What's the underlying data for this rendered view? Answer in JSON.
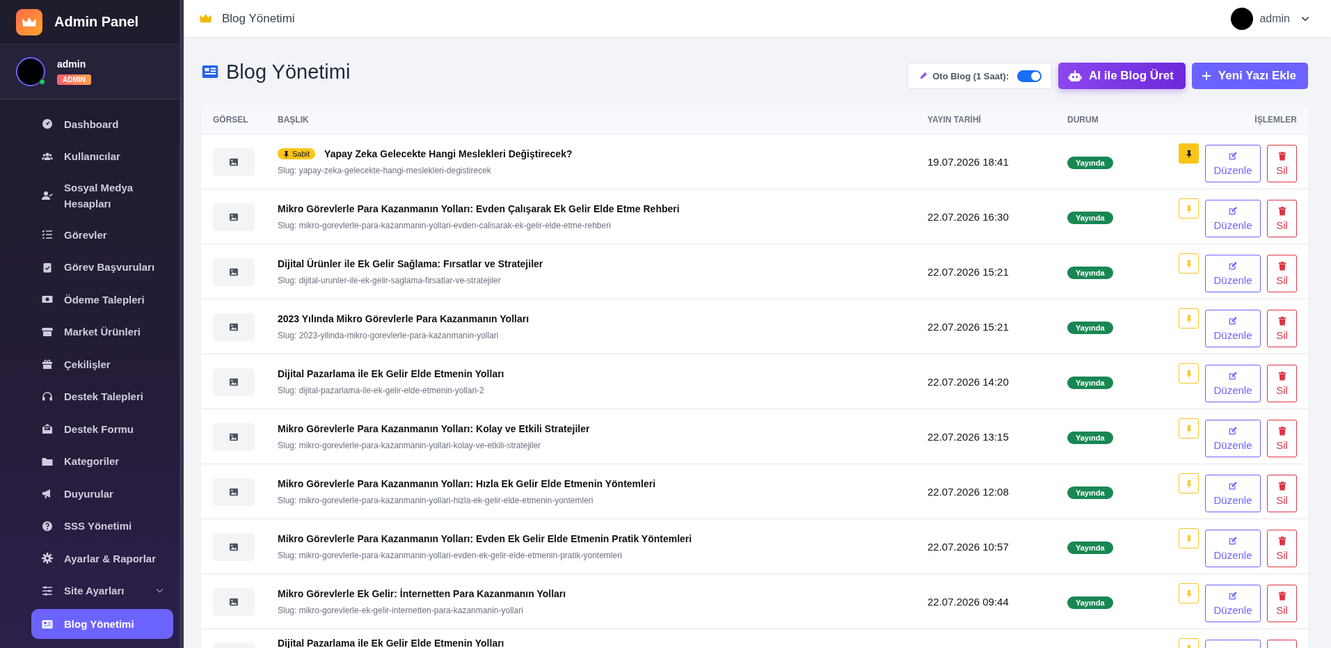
{
  "sidebar": {
    "brand": "Admin Panel",
    "user": {
      "name": "admin",
      "role": "ADMIN",
      "online": true
    },
    "items": [
      {
        "label": "Dashboard",
        "kind": "link",
        "selected": false
      },
      {
        "label": "Kullanıcılar",
        "kind": "link",
        "selected": false
      },
      {
        "label": "Sosyal Medya Hesapları",
        "kind": "link",
        "selected": false
      },
      {
        "label": "Görevler",
        "kind": "link",
        "selected": false
      },
      {
        "label": "Görev Başvuruları",
        "kind": "link",
        "selected": false
      },
      {
        "label": "Ödeme Talepleri",
        "kind": "link",
        "selected": false
      },
      {
        "label": "Market Ürünleri",
        "kind": "link",
        "selected": false
      },
      {
        "label": "Çekilişler",
        "kind": "link",
        "selected": false
      },
      {
        "label": "Destek Talepleri",
        "kind": "link",
        "selected": false
      },
      {
        "label": "Destek Formu",
        "kind": "link",
        "selected": false
      },
      {
        "label": "Kategoriler",
        "kind": "link",
        "selected": false
      },
      {
        "label": "Duyurular",
        "kind": "link",
        "selected": false
      },
      {
        "label": "SSS Yönetimi",
        "kind": "link",
        "selected": false
      },
      {
        "label": "Ayarlar & Raporlar",
        "kind": "link",
        "selected": false
      },
      {
        "label": "Site Ayarları",
        "kind": "group",
        "selected": false
      },
      {
        "label": "Blog Yönetimi",
        "kind": "link",
        "selected": true
      }
    ]
  },
  "topbar": {
    "title": "Blog Yönetimi",
    "user": "admin"
  },
  "page": {
    "title": "Blog Yönetimi",
    "auto_blog": {
      "label": "Oto Blog (1 Saat):",
      "on": true
    },
    "buttons": [
      {
        "label": "AI ile Blog Üret",
        "kind": "ai"
      },
      {
        "label": "Yeni Yazı Ekle",
        "kind": "add"
      }
    ]
  },
  "table": {
    "columns": [
      "GÖRSEL",
      "BAŞLIK",
      "YAYIN TARİHİ",
      "DURUM",
      "İŞLEMLER"
    ],
    "pinned_badge": "Sabit",
    "rows": [
      {
        "title": "Yapay Zeka Gelecekte Hangi Meslekleri Değiştirecek?",
        "slug": "Slug: yapay-zeka-gelecekte-hangi-meslekleri-degistirecek",
        "date": "19.07.2026 18:41",
        "status": "Yayında",
        "pinned": true,
        "edit_label": "Düzenle",
        "delete_label": "Sil"
      },
      {
        "title": "Mikro Görevlerle Para Kazanmanın Yolları: Evden Çalışarak Ek Gelir Elde Etme Rehberi",
        "slug": "Slug: mikro-gorevlerle-para-kazanmanin-yollari-evden-calisarak-ek-gelir-elde-etme-rehberi",
        "date": "22.07.2026 16:30",
        "status": "Yayında",
        "pinned": false,
        "edit_label": "Düzenle",
        "delete_label": "Sil"
      },
      {
        "title": "Dijital Ürünler ile Ek Gelir Sağlama: Fırsatlar ve Stratejiler",
        "slug": "Slug: dijital-urunler-ile-ek-gelir-saglama-firsatlar-ve-stratejiler",
        "date": "22.07.2026 15:21",
        "status": "Yayında",
        "pinned": false,
        "edit_label": "Düzenle",
        "delete_label": "Sil"
      },
      {
        "title": "2023 Yılında Mikro Görevlerle Para Kazanmanın Yolları",
        "slug": "Slug: 2023-yilinda-mikro-gorevlerle-para-kazanmanin-yollari",
        "date": "22.07.2026 15:21",
        "status": "Yayında",
        "pinned": false,
        "edit_label": "Düzenle",
        "delete_label": "Sil"
      },
      {
        "title": "Dijital Pazarlama ile Ek Gelir Elde Etmenin Yolları",
        "slug": "Slug: dijital-pazarlama-ile-ek-gelir-elde-etmenin-yollari-2",
        "date": "22.07.2026 14:20",
        "status": "Yayında",
        "pinned": false,
        "edit_label": "Düzenle",
        "delete_label": "Sil"
      },
      {
        "title": "Mikro Görevlerle Para Kazanmanın Yolları: Kolay ve Etkili Stratejiler",
        "slug": "Slug: mikro-gorevlerle-para-kazanmanin-yollari-kolay-ve-etkili-stratejiler",
        "date": "22.07.2026 13:15",
        "status": "Yayında",
        "pinned": false,
        "edit_label": "Düzenle",
        "delete_label": "Sil"
      },
      {
        "title": "Mikro Görevlerle Para Kazanmanın Yolları: Hızla Ek Gelir Elde Etmenin Yöntemleri",
        "slug": "Slug: mikro-gorevlerle-para-kazanmanin-yollari-hizla-ek-gelir-elde-etmenin-yontemleri",
        "date": "22.07.2026 12:08",
        "status": "Yayında",
        "pinned": false,
        "edit_label": "Düzenle",
        "delete_label": "Sil"
      },
      {
        "title": "Mikro Görevlerle Para Kazanmanın Yolları: Evden Ek Gelir Elde Etmenin Pratik Yöntemleri",
        "slug": "Slug: mikro-gorevlerle-para-kazanmanin-yollari-evden-ek-gelir-elde-etmenin-pratik-yontemleri",
        "date": "22.07.2026 10:57",
        "status": "Yayında",
        "pinned": false,
        "edit_label": "Düzenle",
        "delete_label": "Sil"
      },
      {
        "title": "Mikro Görevlerle Ek Gelir: İnternetten Para Kazanmanın Yolları",
        "slug": "Slug: mikro-gorevlerle-ek-gelir-internetten-para-kazanmanin-yollari",
        "date": "22.07.2026 09:44",
        "status": "Yayında",
        "pinned": false,
        "edit_label": "Düzenle",
        "delete_label": "Sil"
      },
      {
        "title": "Dijital Pazarlama ile Ek Gelir Elde Etmenin Yolları",
        "pinned": false
      }
    ]
  }
}
